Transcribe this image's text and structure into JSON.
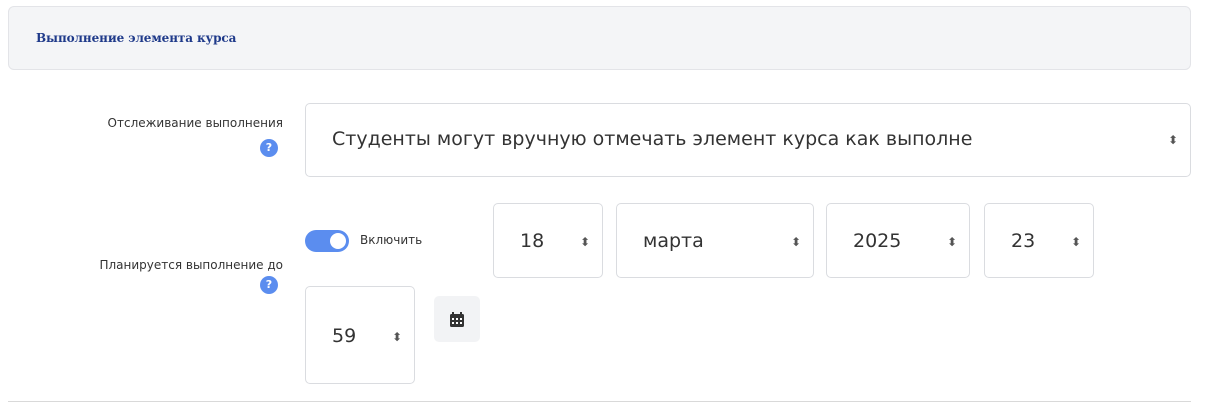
{
  "section": {
    "title": "Выполнение элемента курса"
  },
  "completion_tracking": {
    "label": "Отслеживание выполнения",
    "help": "?",
    "value": "Студенты могут вручную отмечать элемент курса как выполне",
    "arrow": "⬍"
  },
  "expected_completion": {
    "label": "Планируется выполнение до",
    "help": "?",
    "toggle_label": "Включить",
    "toggle_on": true,
    "day": "18",
    "month": "марта",
    "year": "2025",
    "hour": "23",
    "minute": "59",
    "arrow": "⬍"
  },
  "icons": {
    "calendar": "calendar-icon",
    "help": "help-icon"
  },
  "colors": {
    "accent": "#5b8def",
    "title": "#1f3a8a",
    "header_bg": "#f4f5f7"
  }
}
